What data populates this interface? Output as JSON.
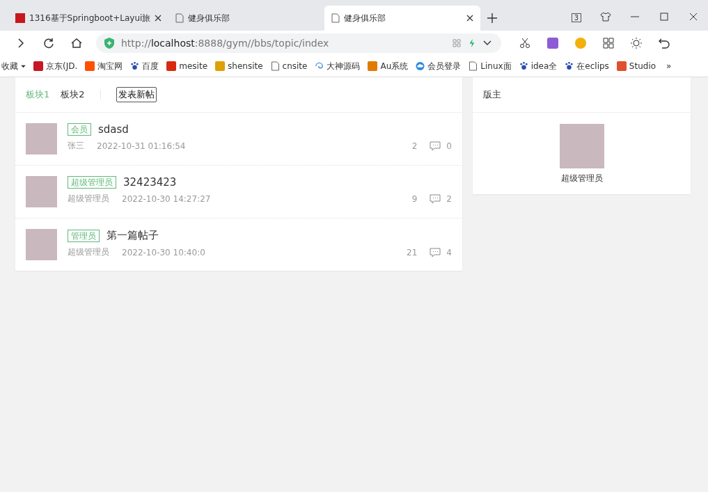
{
  "browser": {
    "tabs": [
      {
        "title": "1316基于Springboot+Layui旅",
        "selected": false,
        "kind": "site"
      },
      {
        "title": "健身俱乐部",
        "selected": false,
        "kind": "page"
      },
      {
        "title": "健身俱乐部",
        "selected": true,
        "kind": "page"
      }
    ],
    "tab_count": "3",
    "address": "http://**localhost**:8888/gym//bbs/topic/index",
    "bookmarks": [
      {
        "label": "收藏",
        "kind": "folder"
      },
      {
        "label": "京东(JD.",
        "kind": "jd"
      },
      {
        "label": "淘宝网",
        "kind": "tao"
      },
      {
        "label": "百度",
        "kind": "paw"
      },
      {
        "label": "mesite",
        "kind": "red"
      },
      {
        "label": "shensite",
        "kind": "shen"
      },
      {
        "label": "cnsite",
        "kind": "page"
      },
      {
        "label": "大神源码",
        "kind": "swirl"
      },
      {
        "label": "Au系统",
        "kind": "au"
      },
      {
        "label": "会员登录",
        "kind": "cloud"
      },
      {
        "label": "Linux面",
        "kind": "page"
      },
      {
        "label": "idea全",
        "kind": "paw"
      },
      {
        "label": "在eclips",
        "kind": "paw"
      },
      {
        "label": "Studio",
        "kind": "studio"
      }
    ],
    "more": "»"
  },
  "forum": {
    "sections": [
      {
        "label": "板块1",
        "selected": true
      },
      {
        "label": "板块2",
        "selected": false
      }
    ],
    "new_post": "发表新帖",
    "posts": [
      {
        "badge": "会员",
        "title": "sdasd",
        "author": "张三",
        "time": "2022-10-31 01:16:54",
        "views": "2",
        "comments": "0"
      },
      {
        "badge": "超级管理员",
        "title": "32423423",
        "author": "超级管理员",
        "time": "2022-10-30 14:27:27",
        "views": "9",
        "comments": "2"
      },
      {
        "badge": "管理员",
        "title": "第一篇帖子",
        "author": "超级管理员",
        "time": "2022-10-30 10:40:0",
        "views": "21",
        "comments": "4"
      }
    ]
  },
  "moderators": {
    "title": "版主",
    "items": [
      {
        "name": "超级管理员"
      }
    ]
  }
}
